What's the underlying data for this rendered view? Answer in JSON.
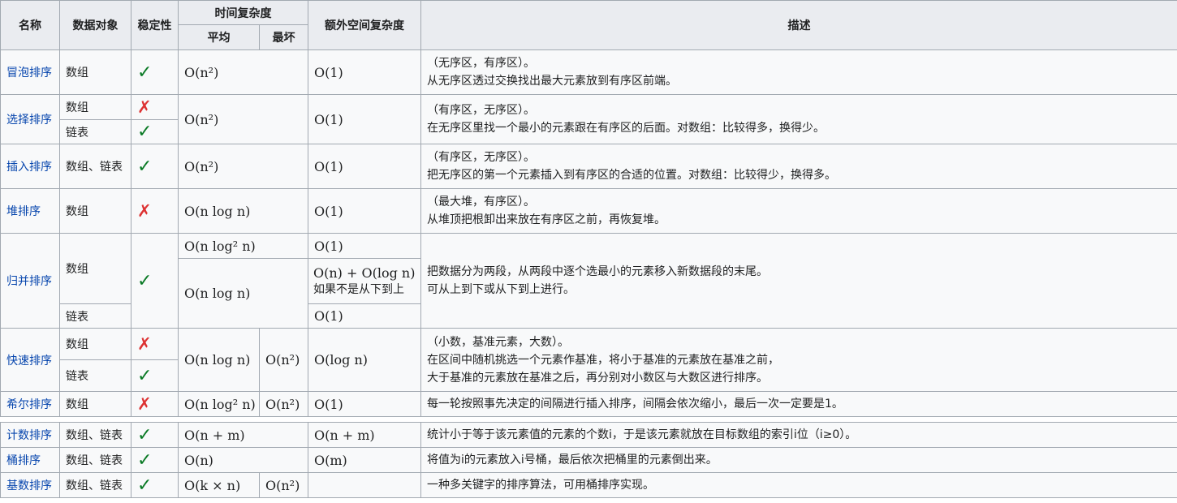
{
  "headers": {
    "name": "名称",
    "data_object": "数据对象",
    "stability": "稳定性",
    "time_complexity": "时间复杂度",
    "average": "平均",
    "worst": "最坏",
    "extra_space": "额外空间复杂度",
    "description": "描述"
  },
  "rows": {
    "bubble": {
      "name": "冒泡排序",
      "obj": "数组",
      "stable": "✓",
      "time": "O(n²)",
      "space": "O(1)",
      "desc1": "（无序区，有序区）。",
      "desc2": "从无序区透过交换找出最大元素放到有序区前端。"
    },
    "selection": {
      "name": "选择排序",
      "obj1": "数组",
      "stable1": "✗",
      "obj2": "链表",
      "stable2": "✓",
      "time": "O(n²)",
      "space": "O(1)",
      "desc1": "（有序区，无序区）。",
      "desc2": "在无序区里找一个最小的元素跟在有序区的后面。对数组：比较得多，换得少。"
    },
    "insertion": {
      "name": "插入排序",
      "obj": "数组、链表",
      "stable": "✓",
      "time": "O(n²)",
      "space": "O(1)",
      "desc1": "（有序区，无序区）。",
      "desc2": "把无序区的第一个元素插入到有序区的合适的位置。对数组：比较得少，换得多。"
    },
    "heap": {
      "name": "堆排序",
      "obj": "数组",
      "stable": "✗",
      "time": "O(n log n)",
      "space": "O(1)",
      "desc1": "（最大堆，有序区）。",
      "desc2": "从堆顶把根卸出来放在有序区之前，再恢复堆。"
    },
    "merge": {
      "name": "归并排序",
      "obj1": "数组",
      "obj2": "链表",
      "stable": "✓",
      "time1": "O(n log² n)",
      "space1": "O(1)",
      "time2": "O(n log n)",
      "space2": "O(n) + O(log n)",
      "space2_note": "如果不是从下到上",
      "space3": "O(1)",
      "desc1": "把数据分为两段，从两段中逐个选最小的元素移入新数据段的末尾。",
      "desc2": "可从上到下或从下到上进行。"
    },
    "quick": {
      "name": "快速排序",
      "obj1": "数组",
      "stable1": "✗",
      "obj2": "链表",
      "stable2": "✓",
      "time_avg": "O(n log n)",
      "time_worst": "O(n²)",
      "space": "O(log n)",
      "desc1": "（小数，基准元素，大数）。",
      "desc2": "在区间中随机挑选一个元素作基准，将小于基准的元素放在基准之前，",
      "desc3": "大于基准的元素放在基准之后，再分别对小数区与大数区进行排序。"
    },
    "shell": {
      "name": "希尔排序",
      "obj": "数组",
      "stable": "✗",
      "time_avg": "O(n log² n)",
      "time_worst": "O(n²)",
      "space": "O(1)",
      "desc": "每一轮按照事先决定的间隔进行插入排序，间隔会依次缩小，最后一次一定要是1。"
    },
    "counting": {
      "name": "计数排序",
      "obj": "数组、链表",
      "stable": "✓",
      "time": "O(n + m)",
      "space": "O(n + m)",
      "desc": "统计小于等于该元素值的元素的个数i，于是该元素就放在目标数组的索引i位（i≥0）。"
    },
    "bucket": {
      "name": "桶排序",
      "obj": "数组、链表",
      "stable": "✓",
      "time": "O(n)",
      "space": "O(m)",
      "desc": "将值为i的元素放入i号桶，最后依次把桶里的元素倒出来。"
    },
    "radix": {
      "name": "基数排序",
      "obj": "数组、链表",
      "stable": "✓",
      "time_avg": "O(k × n)",
      "time_worst": "O(n²)",
      "space": "",
      "desc": "一种多关键字的排序算法，可用桶排序实现。"
    }
  }
}
